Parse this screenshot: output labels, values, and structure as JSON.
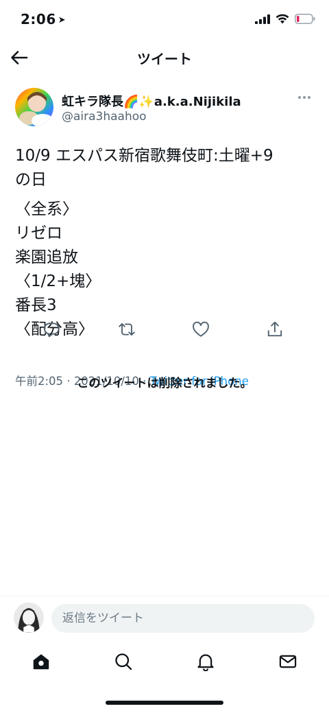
{
  "status_bar": {
    "time": "2:06",
    "location_arrow": "location-arrow-icon"
  },
  "nav": {
    "title": "ツイート",
    "back_icon": "back-arrow-icon"
  },
  "tweet": {
    "author_name": "虹キラ隊長🌈✨a.k.a.Nijikila",
    "author_handle": "@aira3haahoo",
    "text_lines": [
      "10/9 エスパス新宿歌舞伎町:土曜+9",
      "の日",
      "〈全系〉",
      "リゼロ",
      "楽園追放",
      "〈1/2+塊〉",
      "番長3",
      "〈配分高〉"
    ],
    "time": "午前2:05",
    "separator": "·",
    "date": "2021/10/10",
    "source": "Twitter for iPhone"
  },
  "actions": {
    "reply_icon": "reply-icon",
    "retweet_icon": "retweet-icon",
    "like_icon": "heart-icon",
    "share_icon": "share-icon"
  },
  "deleted_notice": "このツイートは削除されました。",
  "reply": {
    "placeholder": "返信をツイート"
  },
  "tabs": [
    "home-icon",
    "search-icon",
    "notifications-icon",
    "messages-icon"
  ],
  "colors": {
    "accent": "#1d9bf0",
    "text": "#0f1419",
    "secondary": "#536471",
    "battery_low": "#e0245e"
  }
}
